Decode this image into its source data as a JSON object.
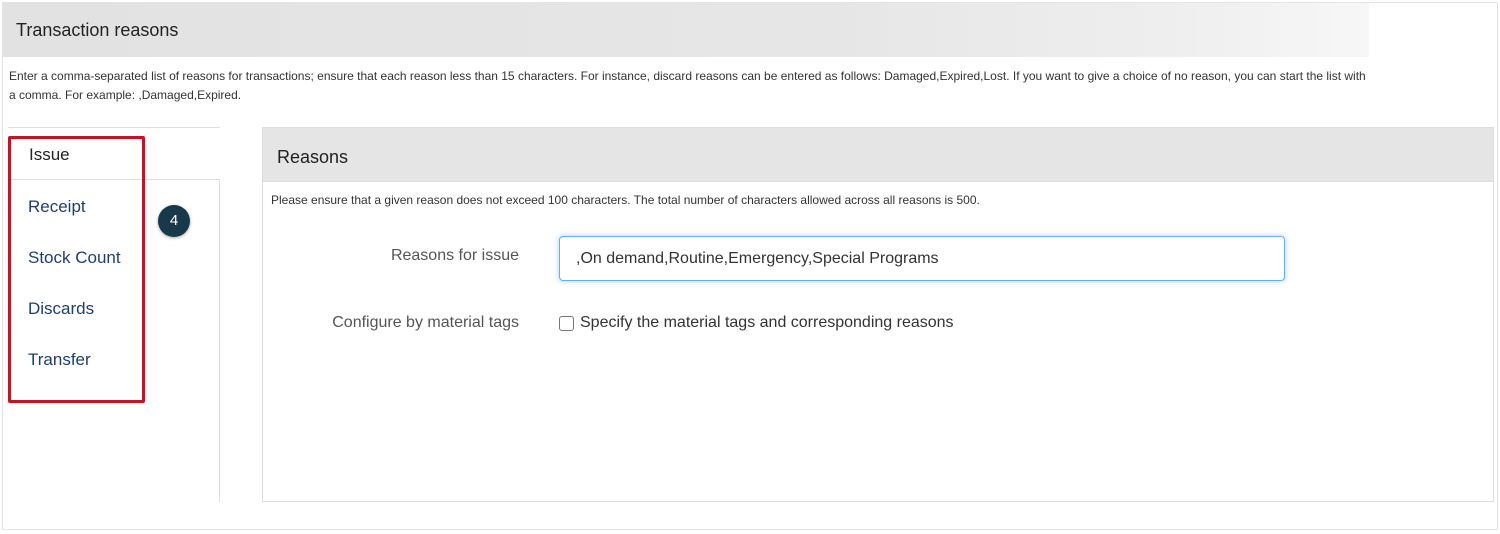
{
  "section": {
    "title": "Transaction reasons",
    "description": "Enter a comma-separated list of reasons for transactions; ensure that each reason less than 15 characters. For instance, discard reasons can be entered as follows: Damaged,Expired,Lost. If you want to give a choice of no reason, you can start the list with a comma. For example: ,Damaged,Expired."
  },
  "nav": {
    "items": [
      {
        "label": "Issue",
        "active": true
      },
      {
        "label": "Receipt",
        "active": false
      },
      {
        "label": "Stock Count",
        "active": false
      },
      {
        "label": "Discards",
        "active": false
      },
      {
        "label": "Transfer",
        "active": false
      }
    ],
    "step_badge": "4"
  },
  "panel": {
    "title": "Reasons",
    "note": "Please ensure that a given reason does not exceed 100 characters. The total number of characters allowed across all reasons is 500.",
    "reasons_label": "Reasons for issue",
    "reasons_value": ",On demand,Routine,Emergency,Special Programs",
    "tags_label": "Configure by material tags",
    "tags_checkbox_label": "Specify the material tags and corresponding reasons",
    "tags_checked": false
  },
  "colors": {
    "highlight": "#c0161f",
    "badge": "#17394a",
    "link": "#1f3f6b",
    "input_focus": "#66afe9"
  }
}
